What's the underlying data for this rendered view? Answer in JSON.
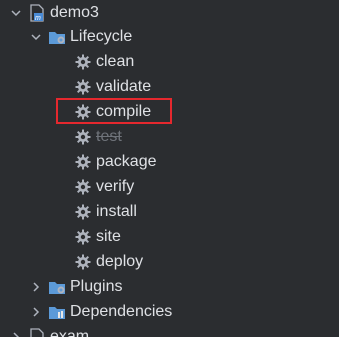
{
  "tree": {
    "project": {
      "label": "demo3",
      "icon": "maven-module-icon"
    },
    "lifecycle": {
      "label": "Lifecycle",
      "icon": "lifecycle-folder-icon",
      "goals": [
        {
          "label": "clean",
          "icon": "gear-icon",
          "disabled": false
        },
        {
          "label": "validate",
          "icon": "gear-icon",
          "disabled": false
        },
        {
          "label": "compile",
          "icon": "gear-icon",
          "disabled": false,
          "highlighted": true
        },
        {
          "label": "test",
          "icon": "gear-icon",
          "disabled": true
        },
        {
          "label": "package",
          "icon": "gear-icon",
          "disabled": false
        },
        {
          "label": "verify",
          "icon": "gear-icon",
          "disabled": false
        },
        {
          "label": "install",
          "icon": "gear-icon",
          "disabled": false
        },
        {
          "label": "site",
          "icon": "gear-icon",
          "disabled": false
        },
        {
          "label": "deploy",
          "icon": "gear-icon",
          "disabled": false
        }
      ]
    },
    "plugins": {
      "label": "Plugins",
      "icon": "plugins-folder-icon"
    },
    "dependencies": {
      "label": "Dependencies",
      "icon": "dependencies-folder-icon"
    },
    "next_project": {
      "label": "exam",
      "icon": "maven-module-icon"
    }
  },
  "colors": {
    "background": "#2b2d30",
    "text": "#dfe1e5",
    "highlight_border": "#e5282e",
    "folder_blue": "#5c9ad8",
    "gear_gray": "#aeb3bd"
  }
}
